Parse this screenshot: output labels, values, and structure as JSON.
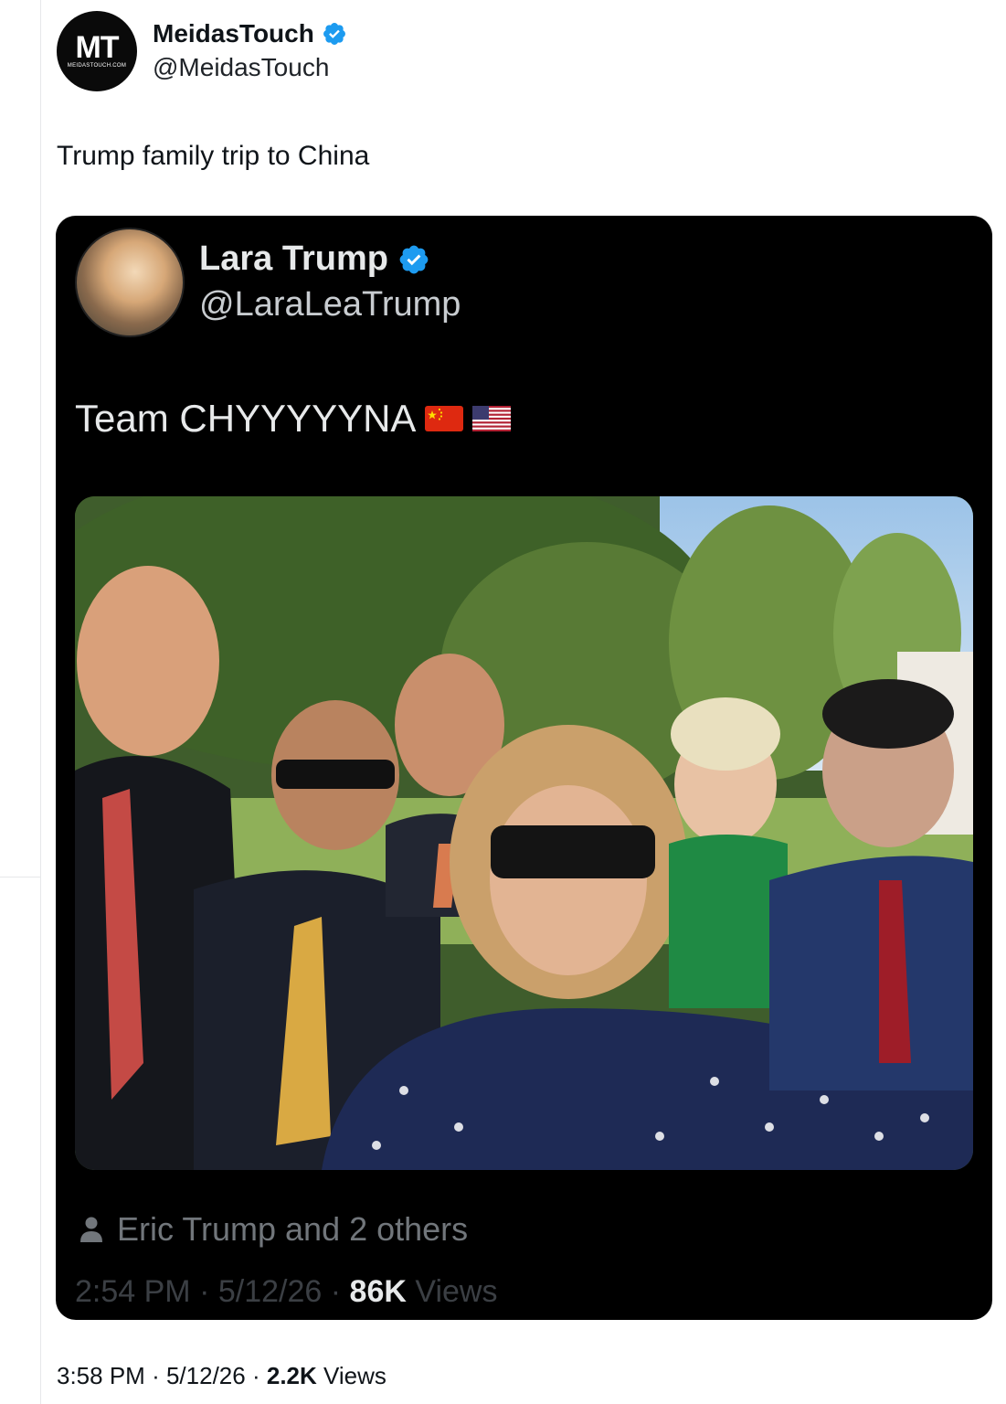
{
  "author": {
    "avatar_text": "MT",
    "avatar_subtext": "MEIDASTOUCH.COM",
    "name": "MeidasTouch",
    "handle": "@MeidasTouch",
    "verified": true
  },
  "tweet": {
    "text": "Trump family trip to China",
    "time": "3:58 PM",
    "date": "5/12/26",
    "views_count": "2.2K",
    "views_label": "Views",
    "separator": "·"
  },
  "quoted": {
    "name": "Lara Trump",
    "handle": "@LaraLeaTrump",
    "verified": true,
    "text": "Team CHYYYYYNA",
    "flags": [
      "china-flag-icon",
      "us-flag-icon"
    ],
    "tagged": "Eric Trump and 2 others",
    "time": "2:54 PM",
    "date": "5/12/26",
    "views_count": "86K",
    "views_label": "Views",
    "separator": "·"
  },
  "colors": {
    "verified_blue": "#1d9bf0",
    "quote_bg": "#000000",
    "muted": "#71767b"
  }
}
